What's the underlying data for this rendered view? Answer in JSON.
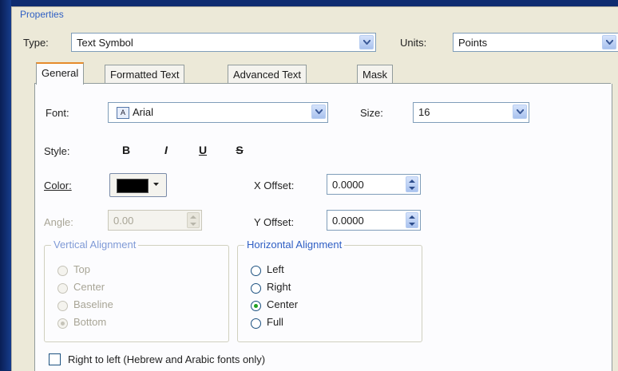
{
  "panel": {
    "title": "Properties"
  },
  "type": {
    "label": "Type:",
    "value": "Text Symbol"
  },
  "units": {
    "label": "Units:",
    "value": "Points"
  },
  "tabs": [
    {
      "label": "General",
      "active": true
    },
    {
      "label": "Formatted Text"
    },
    {
      "label": "Advanced Text"
    },
    {
      "label": "Mask"
    }
  ],
  "font": {
    "label": "Font:",
    "value": "Arial",
    "icon": "font-type-icon"
  },
  "size": {
    "label": "Size:",
    "value": "16"
  },
  "style": {
    "label": "Style:",
    "bold": "B",
    "italic": "I",
    "underline": "U",
    "strikethrough": "S"
  },
  "color": {
    "label": "Color:",
    "value_hex": "#000000"
  },
  "angle": {
    "label": "Angle:",
    "value": "0.00"
  },
  "x_offset": {
    "label": "X Offset:",
    "value": "0.0000"
  },
  "y_offset": {
    "label": "Y Offset:",
    "value": "0.0000"
  },
  "vertical_alignment": {
    "title": "Vertical Alignment",
    "options": [
      "Top",
      "Center",
      "Baseline",
      "Bottom"
    ],
    "selected": "Bottom"
  },
  "horizontal_alignment": {
    "title": "Horizontal Alignment",
    "options": [
      "Left",
      "Right",
      "Center",
      "Full"
    ],
    "selected": "Center"
  },
  "rtl": {
    "label": "Right to left (Hebrew and Arabic fonts only)"
  }
}
